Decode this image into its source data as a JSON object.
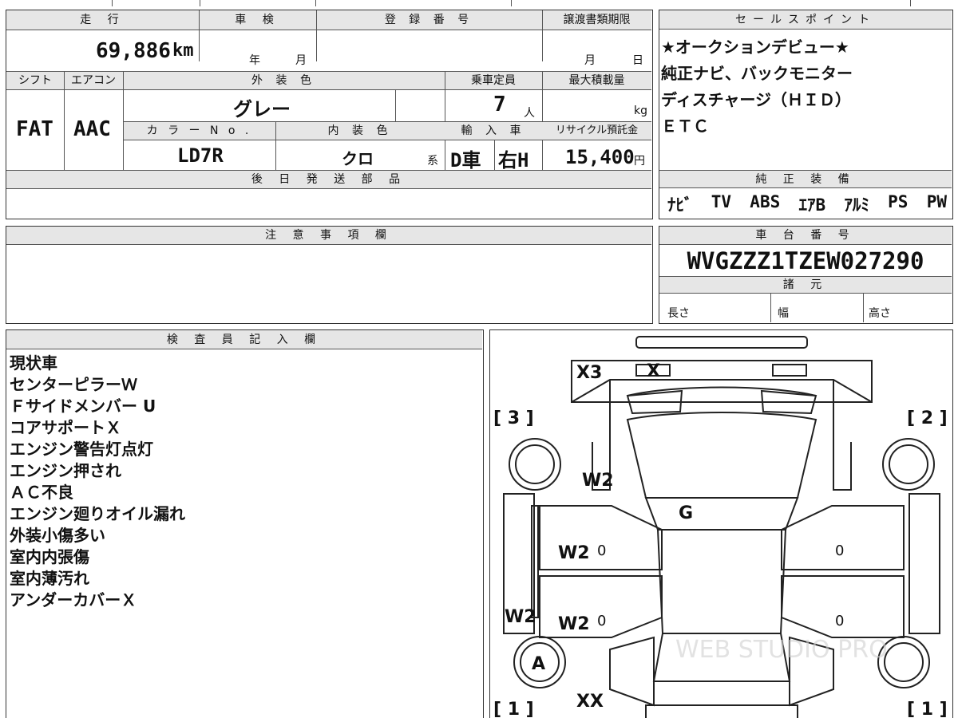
{
  "top_strip": [
    "",
    "",
    "",
    "",
    ""
  ],
  "vehicle": {
    "mileage_label": "走 行",
    "mileage_value": "69,886",
    "mileage_unit": "km",
    "inspection_label": "車 検",
    "inspection_year_unit": "年",
    "inspection_month_unit": "月",
    "registration_label": "登 録 番 号",
    "registration_value": "",
    "transfer_deadline_label": "譲渡書類期限",
    "transfer_month_unit": "月",
    "transfer_day_unit": "日",
    "shift_label": "シフト",
    "shift_value": "FAT",
    "aircon_label": "エアコン",
    "aircon_value": "AAC",
    "exterior_color_label": "外 装 色",
    "exterior_color_value": "グレー",
    "capacity_label": "乗車定員",
    "capacity_value": "7",
    "capacity_unit": "人",
    "max_load_label": "最大積載量",
    "max_load_unit": "kg",
    "color_no_label": "カ ラ ー N o .",
    "color_no_value": "LD7R",
    "interior_color_label": "内 装 色",
    "interior_color_value": "クロ",
    "interior_suffix": "系",
    "import_label": "輸 入 車",
    "import_type": "D車",
    "steering": "右H",
    "recycle_label": "リサイクル預託金",
    "recycle_value": "15,400",
    "recycle_unit": "円",
    "later_parts_label": "後 日 発 送 部 品",
    "later_parts_value": ""
  },
  "sales_points": {
    "header": "セールスポイント",
    "lines": [
      "★オークションデビュー★",
      "純正ナビ、バックモニター",
      "ディスチャージ（ＨＩＤ）",
      "ＥＴＣ"
    ]
  },
  "equipment": {
    "header": "純 正 装 備",
    "items": [
      "ﾅﾋﾞ",
      "TV",
      "ABS",
      "ｴｱB",
      "ｱﾙﾐ",
      "PS",
      "PW"
    ]
  },
  "notes": {
    "header": "注 意 事 項 欄",
    "value": ""
  },
  "chassis": {
    "header": "車 台 番 号",
    "value": "WVGZZZ1TZEW027290",
    "specs_header": "諸 元",
    "length_label": "長さ",
    "width_label": "幅",
    "height_label": "高さ"
  },
  "inspector": {
    "header": "検 査 員 記 入 欄",
    "lines": [
      "現状車",
      "センターピラーＷ",
      "Ｆサイドメンバー U",
      "コアサポートＸ",
      "エンジン警告灯点灯",
      "エンジン押され",
      "ＡＣ不良",
      "エンジン廻りオイル漏れ",
      "外装小傷多い",
      "室内内張傷",
      "室内薄汚れ",
      "アンダーカバーＸ"
    ]
  },
  "diagram": {
    "marks": {
      "x3": "X3",
      "x_top": "X",
      "w2_top": "W2",
      "g": "G",
      "w2_mid1": "W2",
      "w2_mid2": "W2",
      "w2_side": "W2",
      "a": "A",
      "xx": "XX",
      "zero1": "0",
      "zero2": "0",
      "zero3": "0",
      "zero4": "0"
    },
    "corner_3": "[ 3 ]",
    "corner_2": "[ 2 ]",
    "corner_1_left": "[ 1 ]",
    "corner_1_right": "[ 1 ]",
    "watermark": "WEB STUDIO PRO"
  }
}
